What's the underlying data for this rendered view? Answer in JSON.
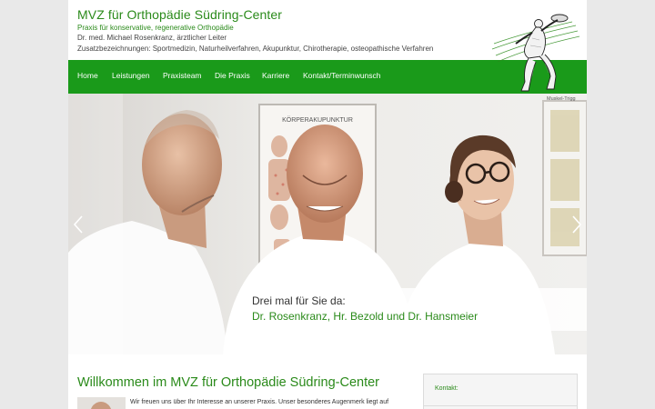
{
  "header": {
    "title": "MVZ für Orthopädie Südring-Center",
    "subtitle": "Praxis für konservative, regenerative Orthopädie",
    "leader": "Dr. med. Michael Rosenkranz, ärztlicher Leiter",
    "qualifications": "Zusatzbezeichnungen: Sportmedizin, Naturheilverfahren, Akupunktur, Chirotherapie, osteopathische Verfahren",
    "logo_icon": "discus-thrower-logo"
  },
  "nav": {
    "items": [
      {
        "label": "Home"
      },
      {
        "label": "Leistungen"
      },
      {
        "label": "Praxisteam"
      },
      {
        "label": "Die Praxis"
      },
      {
        "label": "Karriere"
      },
      {
        "label": "Kontakt/Terminwunsch"
      }
    ]
  },
  "hero": {
    "caption_line1": "Drei mal für Sie da:",
    "caption_line2": "Dr. Rosenkranz, Hr. Bezold und Dr. Hansmeier",
    "poster_title": "KÖRPERAKUPUNKTUR",
    "chart_label": "Muskel-Trigg",
    "prev_icon": "chevron-left-icon",
    "next_icon": "chevron-right-icon"
  },
  "content": {
    "welcome_heading": "Willkommen im MVZ für Orthopädie Südring-Center",
    "intro_text": "Wir freuen uns über Ihr Interesse an unserer Praxis. Unser besonderes Augenmerk liegt auf"
  },
  "sidebar": {
    "contact_label": "Kontakt:"
  },
  "colors": {
    "brand_green": "#1a9a1a",
    "text_green": "#2a8a1a",
    "page_background": "#e9e9e9"
  }
}
